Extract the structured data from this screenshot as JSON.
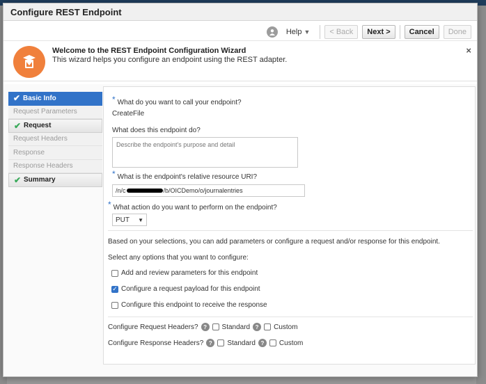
{
  "dialog": {
    "title": "Configure REST Endpoint"
  },
  "toolbar": {
    "help": "Help",
    "back": "< Back",
    "next": "Next >",
    "cancel": "Cancel",
    "done": "Done"
  },
  "welcome": {
    "title": "Welcome to the REST Endpoint Configuration Wizard",
    "subtitle": "This wizard helps you configure an endpoint using the REST adapter.",
    "close": "×"
  },
  "train": {
    "items": [
      {
        "label": "Basic Info",
        "state": "active"
      },
      {
        "label": "Request Parameters",
        "state": "disabled"
      },
      {
        "label": "Request",
        "state": "done"
      },
      {
        "label": "Request Headers",
        "state": "disabled"
      },
      {
        "label": "Response",
        "state": "disabled"
      },
      {
        "label": "Response Headers",
        "state": "disabled"
      },
      {
        "label": "Summary",
        "state": "done"
      }
    ]
  },
  "form": {
    "name_label": "What do you want to call your endpoint?",
    "name_value": "CreateFile",
    "desc_label": "What does this endpoint do?",
    "desc_placeholder": "Describe the endpoint's purpose and detail",
    "uri_label": "What is the endpoint's relative resource URI?",
    "uri_prefix": "/n/c",
    "uri_suffix": "/b/OICDemo/o/journalentries",
    "action_label": "What action do you want to perform on the endpoint?",
    "action_value": "PUT",
    "note": "Based on your selections, you can add parameters or configure a request and/or response for this endpoint.",
    "options_title": "Select any options that you want to configure:",
    "options": [
      {
        "label": "Add and review parameters for this endpoint",
        "checked": false
      },
      {
        "label": "Configure a request payload for this endpoint",
        "checked": true
      },
      {
        "label": "Configure this endpoint to receive the response",
        "checked": false
      }
    ],
    "req_headers_label": "Configure Request Headers?",
    "resp_headers_label": "Configure Response Headers?",
    "standard": "Standard",
    "custom": "Custom"
  },
  "colors": {
    "accent": "#3273c8",
    "badge": "#f0803c",
    "check": "#3aaa5a"
  }
}
